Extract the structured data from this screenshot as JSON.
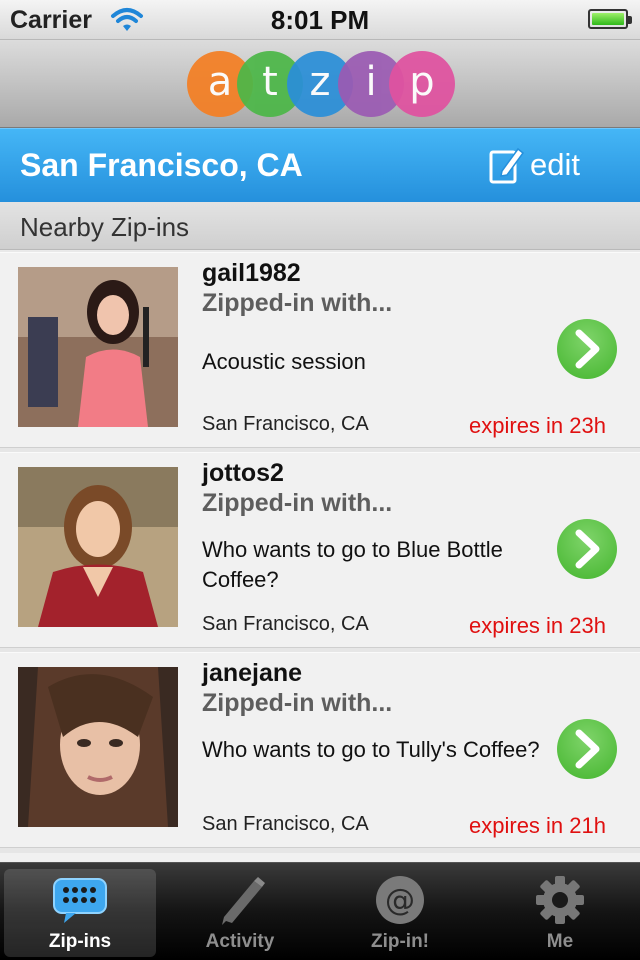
{
  "status_bar": {
    "carrier": "Carrier",
    "time": "8:01 PM"
  },
  "logo": {
    "letters": [
      "a",
      "t",
      "z",
      "i",
      "p"
    ],
    "colors": [
      "#f47f24",
      "#4cb748",
      "#2b8fd8",
      "#9b5bb3",
      "#e052a0"
    ]
  },
  "location": {
    "title": "San Francisco, CA",
    "edit_label": "edit"
  },
  "section": {
    "title": "Nearby Zip-ins"
  },
  "items": [
    {
      "username": "gail1982",
      "status": "Zipped-in with...",
      "message": "Acoustic session",
      "location": "San Francisco, CA",
      "expires": "expires in 23h"
    },
    {
      "username": "jottos2",
      "status": "Zipped-in with...",
      "message": "Who wants to go to Blue Bottle Coffee?",
      "location": "San Francisco, CA",
      "expires": "expires in 23h"
    },
    {
      "username": "janejane",
      "status": "Zipped-in with...",
      "message": "Who wants to go to Tully's Coffee?",
      "location": "San Francisco, CA",
      "expires": "expires in 21h"
    }
  ],
  "tabs": [
    {
      "label": "Zip-ins",
      "icon": "chat-bubble-icon",
      "active": true
    },
    {
      "label": "Activity",
      "icon": "pencil-icon",
      "active": false
    },
    {
      "label": "Zip-in!",
      "icon": "at-sign-icon",
      "active": false
    },
    {
      "label": "Me",
      "icon": "gear-icon",
      "active": false
    }
  ],
  "colors": {
    "accent": "#2a96e0",
    "go_button": "#4cb748",
    "expires": "#e01010"
  }
}
